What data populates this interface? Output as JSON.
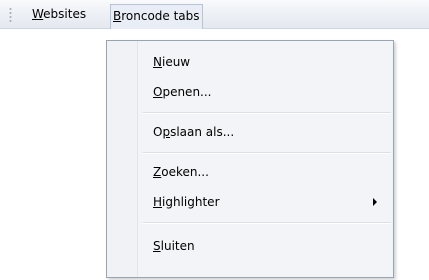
{
  "menubar": {
    "items": [
      {
        "label": "Websites",
        "underline_index": 0
      },
      {
        "label": "Broncode tabs",
        "underline_index": 0
      }
    ]
  },
  "dropdown": {
    "items": [
      {
        "label": "Nieuw",
        "underline_index": 0,
        "submenu": false
      },
      {
        "label": "Openen...",
        "underline_index": 0,
        "submenu": false
      },
      {
        "label": "Opslaan als...",
        "underline_index": 1,
        "submenu": false
      },
      {
        "label": "Zoeken...",
        "underline_index": 0,
        "submenu": false
      },
      {
        "label": "Highlighter",
        "underline_index": 0,
        "submenu": true
      },
      {
        "label": "Sluiten",
        "underline_index": 0,
        "submenu": false
      }
    ]
  }
}
